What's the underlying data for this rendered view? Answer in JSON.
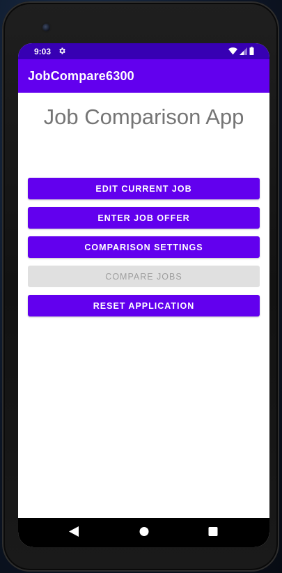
{
  "status_bar": {
    "time": "9:03",
    "icons": [
      "gear-icon",
      "wifi-icon",
      "signal-icon",
      "battery-icon"
    ]
  },
  "app_bar": {
    "title": "JobCompare6300"
  },
  "main": {
    "heading": "Job Comparison App",
    "buttons": [
      {
        "label": "EDIT CURRENT JOB",
        "enabled": true
      },
      {
        "label": "ENTER JOB OFFER",
        "enabled": true
      },
      {
        "label": "COMPARISON SETTINGS",
        "enabled": true
      },
      {
        "label": "COMPARE JOBS",
        "enabled": false
      },
      {
        "label": "RESET APPLICATION",
        "enabled": true
      }
    ]
  },
  "nav_bar": {
    "icons": [
      "back-icon",
      "home-icon",
      "recents-icon"
    ]
  },
  "colors": {
    "primary": "#6200ee",
    "primary_dark": "#3700b3",
    "disabled_bg": "#e0e0e0",
    "disabled_text": "#9e9e9e",
    "heading_text": "#757575"
  }
}
